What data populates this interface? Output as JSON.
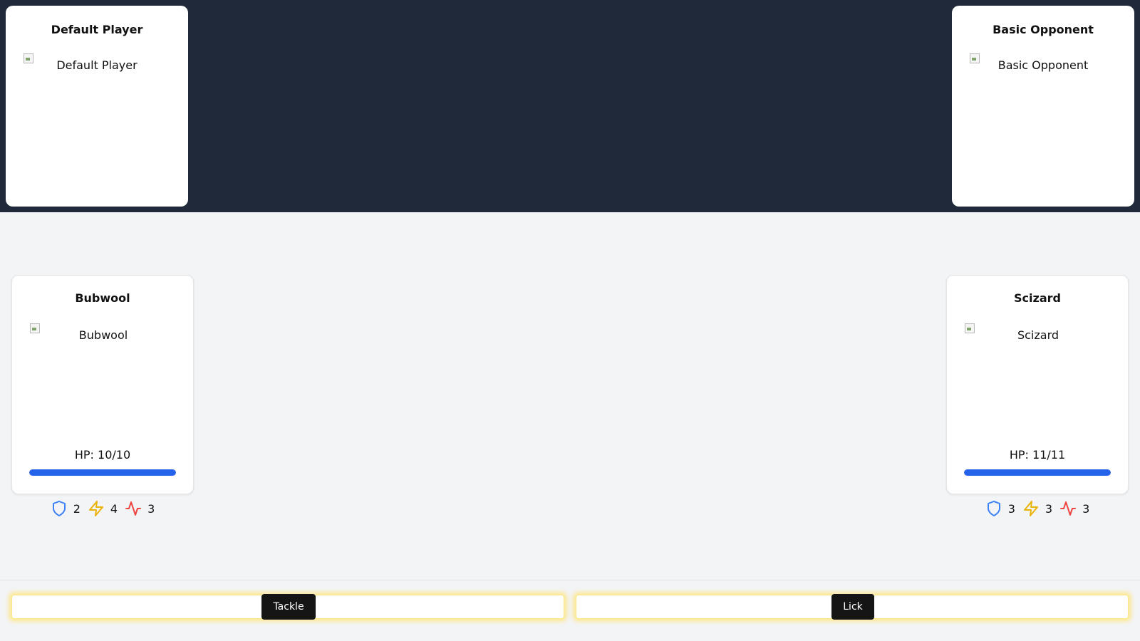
{
  "player": {
    "name": "Default Player",
    "image_alt": "Default Player"
  },
  "opponent": {
    "name": "Basic Opponent",
    "image_alt": "Basic Opponent"
  },
  "player_monster": {
    "name": "Bubwool",
    "image_alt": "Bubwool",
    "hp_text": "HP: 10/10",
    "hp_fraction": 1.0,
    "defense": "2",
    "speed": "4",
    "health": "3"
  },
  "opponent_monster": {
    "name": "Scizard",
    "image_alt": "Scizard",
    "hp_text": "HP: 11/11",
    "hp_fraction": 1.0,
    "defense": "3",
    "speed": "3",
    "health": "3"
  },
  "moves": [
    {
      "label": "Tackle"
    },
    {
      "label": "Lick"
    }
  ],
  "icons": {
    "defense": "shield-icon",
    "speed": "zap-icon",
    "health": "pulse-icon"
  },
  "colors": {
    "header_bg": "#202939",
    "hp_bar": "#2563eb",
    "shield": "#3b82f6",
    "zap": "#eab308",
    "pulse": "#ef4444",
    "move_glow": "#fde68a"
  }
}
